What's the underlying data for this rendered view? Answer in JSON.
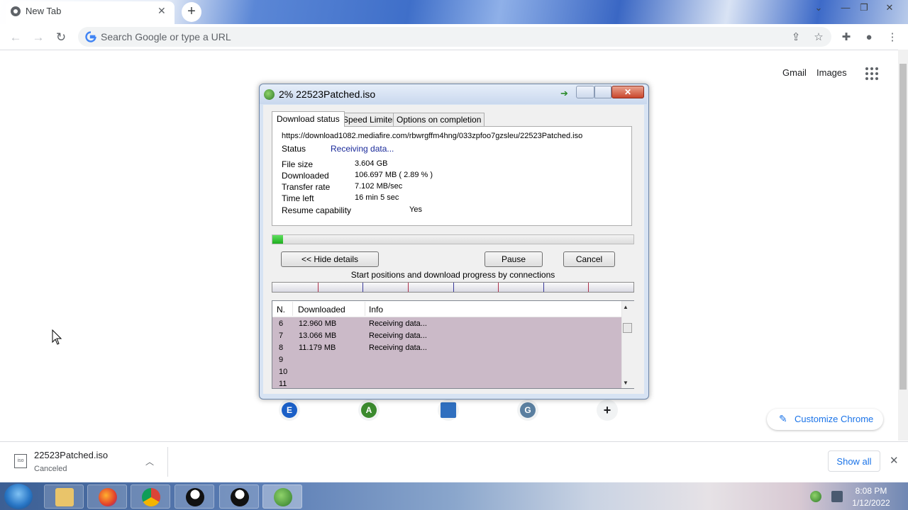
{
  "browser": {
    "tab": {
      "title": "New Tab",
      "close": "✕"
    },
    "newtab": "+",
    "window_controls": {
      "minimize": "—",
      "restore": "❐",
      "close": "✕",
      "menu": "⌄"
    },
    "omnibox": {
      "placeholder": "Search Google or type a URL"
    },
    "nav": {
      "back": "←",
      "forward": "→",
      "reload": "↻"
    },
    "toolbar_icons": {
      "share": "⇪",
      "star": "☆",
      "extensions": "✚",
      "profile": "●",
      "menu": "⋮"
    }
  },
  "ntp": {
    "gmail": "Gmail",
    "images": "Images",
    "shortcuts": [
      {
        "letter": "E",
        "color": "#1a5fc7"
      },
      {
        "letter": "A",
        "color": "#3b8a2e"
      },
      {
        "letter": "",
        "color": "#2f6fbf"
      },
      {
        "letter": "G",
        "color": "#5a7fa0"
      },
      {
        "letter": "+",
        "color": "#f1f3f4"
      }
    ],
    "customize": {
      "label": "Customize Chrome",
      "icon": "✎"
    }
  },
  "download_shelf": {
    "file_name": "22523Patched.iso",
    "status": "Canceled",
    "file_icon": "iso",
    "caret": "︿",
    "show_all": "Show all",
    "close": "✕"
  },
  "idm": {
    "title": "2% 22523Patched.iso",
    "close": "✕",
    "tabs": [
      "Download status",
      "Speed Limiter",
      "Options on completion"
    ],
    "url": "https://download1082.mediafire.com/rbwrgffm4hng/033zpfoo7gzsleu/22523Patched.iso",
    "status_label": "Status",
    "status_value": "Receiving data...",
    "rows": [
      {
        "label": "File size",
        "value": "3.604  GB"
      },
      {
        "label": "Downloaded",
        "value": "106.697  MB  ( 2.89 % )"
      },
      {
        "label": "Transfer rate",
        "value": "7.102  MB/sec"
      },
      {
        "label": "Time left",
        "value": "16 min 5 sec"
      }
    ],
    "resume_label": "Resume capability",
    "resume_value": "Yes",
    "progress_fraction": 0.0289,
    "buttons": {
      "hide_details": "<< Hide details",
      "pause": "Pause",
      "cancel": "Cancel"
    },
    "connections_caption": "Start positions and download progress by connections",
    "connection_count": 8,
    "list": {
      "columns": [
        "N.",
        "Downloaded",
        "Info"
      ],
      "rows": [
        {
          "n": "6",
          "downloaded": "12.960  MB",
          "info": "Receiving data..."
        },
        {
          "n": "7",
          "downloaded": "13.066  MB",
          "info": "Receiving data..."
        },
        {
          "n": "8",
          "downloaded": "11.179  MB",
          "info": "Receiving data..."
        },
        {
          "n": "9",
          "downloaded": "",
          "info": ""
        },
        {
          "n": "10",
          "downloaded": "",
          "info": ""
        },
        {
          "n": "11",
          "downloaded": "",
          "info": ""
        }
      ]
    }
  },
  "taskbar": {
    "time": "8:08 PM",
    "date": "1/12/2022"
  },
  "colors": {
    "accent": "#1a73e8",
    "progress": "#1fae1f",
    "list_row_bg": "#cbbac8",
    "status_text": "#1a2a9a"
  }
}
